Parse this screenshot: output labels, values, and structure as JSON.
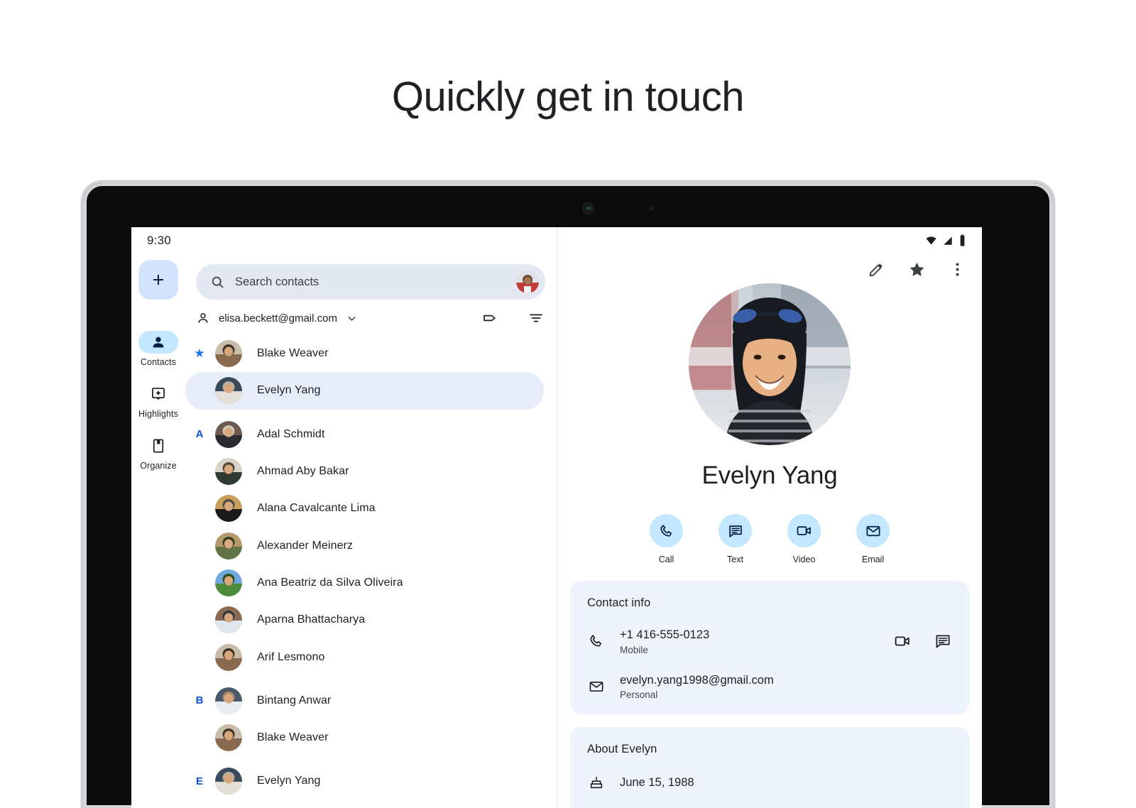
{
  "headline": "Quickly get in touch",
  "status_bar": {
    "time": "9:30",
    "icons": [
      "wifi-icon",
      "cell-signal-icon",
      "battery-icon"
    ]
  },
  "left_pane": {
    "fab": {
      "name": "create-contact-button",
      "icon": "plus-icon"
    },
    "rail": {
      "items": [
        {
          "label": "Contacts",
          "icon": "person-icon",
          "active": true
        },
        {
          "label": "Highlights",
          "icon": "highlights-icon",
          "active": false
        },
        {
          "label": "Organize",
          "icon": "organize-icon",
          "active": false
        }
      ]
    },
    "search": {
      "placeholder": "Search contacts",
      "icon": "search-icon",
      "avatar": "account-avatar"
    },
    "account": {
      "icon": "person-outline-icon",
      "email": "elisa.beckett@gmail.com",
      "chevron": "chevron-down-icon",
      "actions": [
        {
          "name": "label-icon"
        },
        {
          "name": "filter-icon"
        }
      ]
    },
    "contacts": [
      {
        "section": "",
        "starred": true,
        "name": "Blake Weaver",
        "selected": false
      },
      {
        "section": "",
        "starred": false,
        "name": "Evelyn Yang",
        "selected": true
      },
      {
        "section": "A",
        "starred": false,
        "name": "Adal Schmidt",
        "selected": false
      },
      {
        "section": "",
        "starred": false,
        "name": "Ahmad Aby Bakar",
        "selected": false
      },
      {
        "section": "",
        "starred": false,
        "name": "Alana Cavalcante Lima",
        "selected": false
      },
      {
        "section": "",
        "starred": false,
        "name": "Alexander Meinerz",
        "selected": false
      },
      {
        "section": "",
        "starred": false,
        "name": "Ana Beatriz da Silva Oliveira",
        "selected": false
      },
      {
        "section": "",
        "starred": false,
        "name": "Aparna Bhattacharya",
        "selected": false
      },
      {
        "section": "",
        "starred": false,
        "name": "Arif Lesmono",
        "selected": false
      },
      {
        "section": "B",
        "starred": false,
        "name": "Bintang Anwar",
        "selected": false
      },
      {
        "section": "",
        "starred": false,
        "name": "Blake Weaver",
        "selected": false
      },
      {
        "section": "E",
        "starred": false,
        "name": "Evelyn Yang",
        "selected": false
      }
    ]
  },
  "right_pane": {
    "toolbar": [
      {
        "name": "edit-icon"
      },
      {
        "name": "star-icon"
      },
      {
        "name": "more-options-icon"
      }
    ],
    "contact_name": "Evelyn Yang",
    "quick_actions": [
      {
        "label": "Call",
        "icon": "phone-icon"
      },
      {
        "label": "Text",
        "icon": "message-icon"
      },
      {
        "label": "Video",
        "icon": "video-camera-icon"
      },
      {
        "label": "Email",
        "icon": "envelope-icon"
      }
    ],
    "contact_info": {
      "title": "Contact info",
      "rows": [
        {
          "icon": "phone-icon",
          "primary": "+1 416-555-0123",
          "secondary": "Mobile",
          "actions": [
            "video-camera-icon",
            "message-icon"
          ]
        },
        {
          "icon": "envelope-icon",
          "primary": "evelyn.yang1998@gmail.com",
          "secondary": "Personal",
          "actions": []
        }
      ]
    },
    "about": {
      "title": "About Evelyn",
      "rows": [
        {
          "icon": "cake-icon",
          "text": "June 15, 1988"
        }
      ]
    }
  },
  "colors": {
    "accent_blue": "#0b57d0",
    "chip_blue": "#c2e7ff",
    "fab_blue": "#d3e3fd",
    "search_bg": "#e3e8f3",
    "card_bg": "#eef3fc",
    "selected_row": "#e6ecf8",
    "text_primary": "#1f1f1f",
    "text_secondary": "#444746"
  }
}
